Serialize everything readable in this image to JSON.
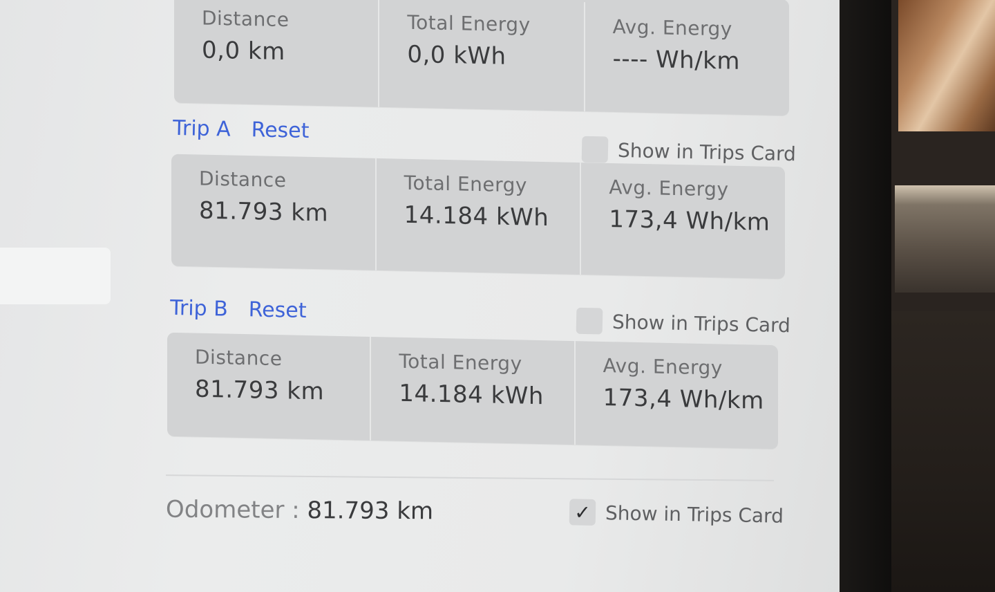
{
  "current": {
    "distance": {
      "label": "Distance",
      "value": "0,0 km"
    },
    "energy": {
      "label": "Total Energy",
      "value": "0,0 kWh"
    },
    "avg": {
      "label": "Avg. Energy",
      "value": "---- Wh/km"
    }
  },
  "trip_a": {
    "title": "Trip A",
    "reset": "Reset",
    "show_label": "Show in Trips Card",
    "show_checked": false,
    "distance": {
      "label": "Distance",
      "value": "81.793 km"
    },
    "energy": {
      "label": "Total Energy",
      "value": "14.184 kWh"
    },
    "avg": {
      "label": "Avg. Energy",
      "value": "173,4 Wh/km"
    }
  },
  "trip_b": {
    "title": "Trip B",
    "reset": "Reset",
    "show_label": "Show in Trips Card",
    "show_checked": false,
    "distance": {
      "label": "Distance",
      "value": "81.793 km"
    },
    "energy": {
      "label": "Total Energy",
      "value": "14.184 kWh"
    },
    "avg": {
      "label": "Avg. Energy",
      "value": "173,4 Wh/km"
    }
  },
  "odometer": {
    "label": "Odometer",
    "separator": " : ",
    "value": "81.793 km",
    "show_label": "Show in Trips Card",
    "show_checked": true,
    "check_glyph": "✓"
  },
  "colors": {
    "accent": "#3e63d8",
    "card": "#d2d3d4",
    "text": "#3a3b3d"
  }
}
